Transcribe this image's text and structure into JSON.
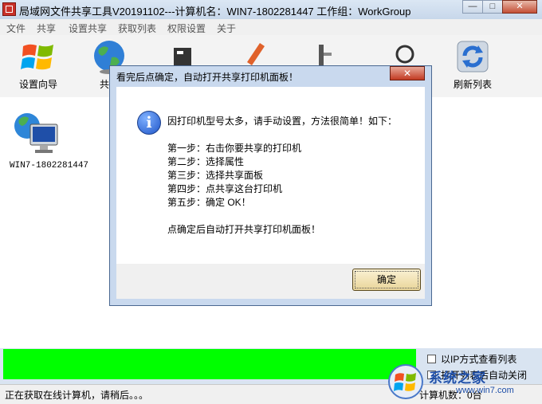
{
  "window": {
    "title": "局域网文件共享工具V20191102---计算机名：WIN7-1802281447  工作组：WorkGroup",
    "minimize_glyph": "—",
    "maximize_glyph": "□",
    "close_glyph": "✕"
  },
  "menu": [
    "文件",
    "共享",
    "设置共享",
    "获取列表",
    "权限设置",
    "关于"
  ],
  "toolbar": {
    "setup_wizard_label": "设置向导",
    "share_label": "共享",
    "refresh_label": "刷新列表"
  },
  "computers": [
    {
      "name": "WIN7-1802281447"
    }
  ],
  "options": {
    "view_by_ip": "以IP方式查看列表",
    "auto_close": "打开列表后自动关闭"
  },
  "status": {
    "left": "正在获取在线计算机，请稍后。。。",
    "right": "计算机数：0台"
  },
  "dialog": {
    "title": "看完后点确定，自动打开共享打印机面板！",
    "close_glyph": "✕",
    "info_glyph": "i",
    "lines": [
      "因打印机型号太多，请手动设置，方法很简单！如下：",
      "第一步：右击你要共享的打印机",
      "第二步：选择属性",
      "第三步：选择共享面板",
      "第四步：点共享这台打印机",
      "第五步：确定   OK！",
      "点确定后自动打开共享打印机面板！"
    ],
    "ok_label": "确定"
  },
  "watermark": {
    "text": "系统之家",
    "url": "www.win7.com"
  }
}
